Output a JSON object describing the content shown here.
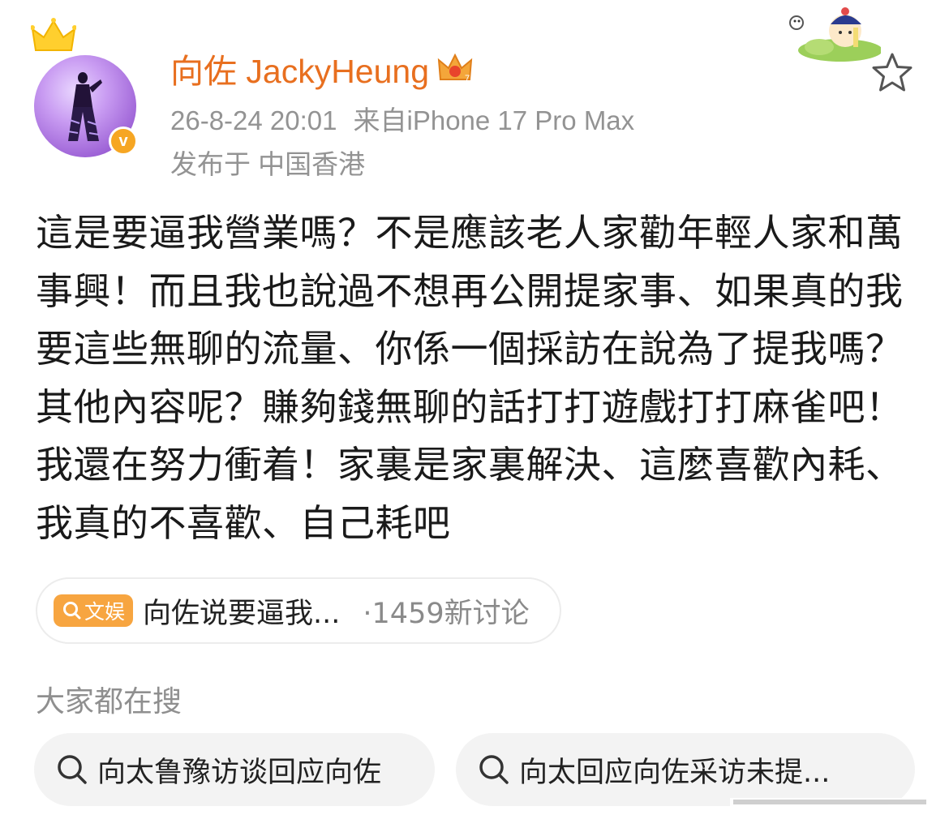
{
  "post": {
    "author": "向佐 JackyHeung",
    "timestamp": "26-8-24 20:01",
    "source": "来自iPhone 17 Pro Max",
    "location": "发布于 中国香港",
    "verified_mark": "v",
    "text": "這是要逼我營業嗎？不是應該老人家勸年輕人家和萬事興！而且我也說過不想再公開提家事、如果真的我要這些無聊的流量、你係一個採訪在說為了提我嗎？其他內容呢？賺夠錢無聊的話打打遊戲打打麻雀吧！我還在努力衝着！家裏是家裏解決、這麼喜歡內耗、我真的不喜歡、自己耗吧"
  },
  "topic": {
    "badge": "文娱",
    "title": "向佐说要逼我...",
    "count": "·1459新讨论"
  },
  "related": {
    "heading": "大家都在搜",
    "items": [
      {
        "label": "向太鲁豫访谈回应向佐"
      },
      {
        "label": "向太回应向佐采访未提..."
      }
    ]
  },
  "colors": {
    "username": "#e86f1f",
    "meta": "#939393",
    "badge": "#f7a540",
    "verified": "#f6a623"
  },
  "icons": [
    "crown-icon",
    "vip-crown-icon",
    "star-icon",
    "search-icon",
    "verified-icon"
  ]
}
